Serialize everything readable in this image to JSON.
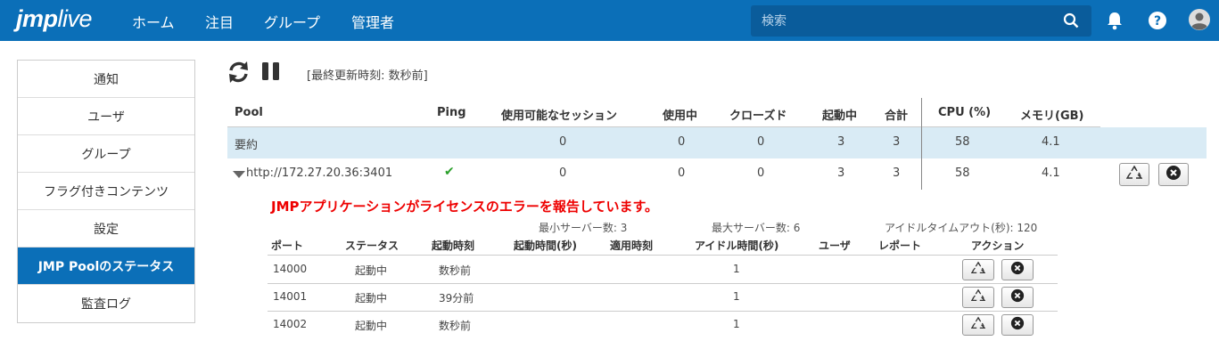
{
  "header": {
    "logo_prefix": "jmp",
    "logo_suffix": "live",
    "nav": [
      "ホーム",
      "注目",
      "グループ",
      "管理者"
    ],
    "search_placeholder": "検索"
  },
  "sidebar": {
    "items": [
      {
        "label": "通知"
      },
      {
        "label": "ユーザ"
      },
      {
        "label": "グループ"
      },
      {
        "label": "フラグ付きコンテンツ"
      },
      {
        "label": "設定"
      },
      {
        "label": "JMP Poolのステータス",
        "active": true
      },
      {
        "label": "監査ログ"
      }
    ]
  },
  "toolbar": {
    "last_updated": "[最終更新時刻: 数秒前]"
  },
  "pool_table": {
    "headers": [
      "Pool",
      "Ping",
      "使用可能なセッション",
      "使用中",
      "クローズド",
      "起動中",
      "合計",
      "CPU (%)",
      "メモリ(GB)"
    ],
    "summary": {
      "name": "要約",
      "available": "0",
      "in_use": "0",
      "closed": "0",
      "starting": "3",
      "total": "3",
      "cpu": "58",
      "memory": "4.1"
    },
    "pool": {
      "name": "http://172.27.20.36:3401",
      "ping": "✔",
      "available": "0",
      "in_use": "0",
      "closed": "0",
      "starting": "3",
      "total": "3",
      "cpu": "58",
      "memory": "4.1"
    }
  },
  "pool_detail": {
    "error": "JMPアプリケーションがライセンスのエラーを報告しています。",
    "min_servers": "最小サーバー数: 3",
    "max_servers": "最大サーバー数: 6",
    "idle_timeout": "アイドルタイムアウト(秒): 120",
    "headers": [
      "ポート",
      "ステータス",
      "起動時刻",
      "起動時間(秒)",
      "適用時刻",
      "アイドル時間(秒)",
      "ユーザ",
      "レポート",
      "アクション"
    ],
    "rows": [
      {
        "port": "14000",
        "status": "起動中",
        "start": "数秒前",
        "idle": "1"
      },
      {
        "port": "14001",
        "status": "起動中",
        "start": "39分前",
        "idle": "1"
      },
      {
        "port": "14002",
        "status": "起動中",
        "start": "数秒前",
        "idle": "1"
      }
    ]
  },
  "colors": {
    "brand": "#0b6fb8",
    "error": "#e00000",
    "ping_ok": "#2aa02a",
    "summary_bg": "#d9ebf5"
  }
}
